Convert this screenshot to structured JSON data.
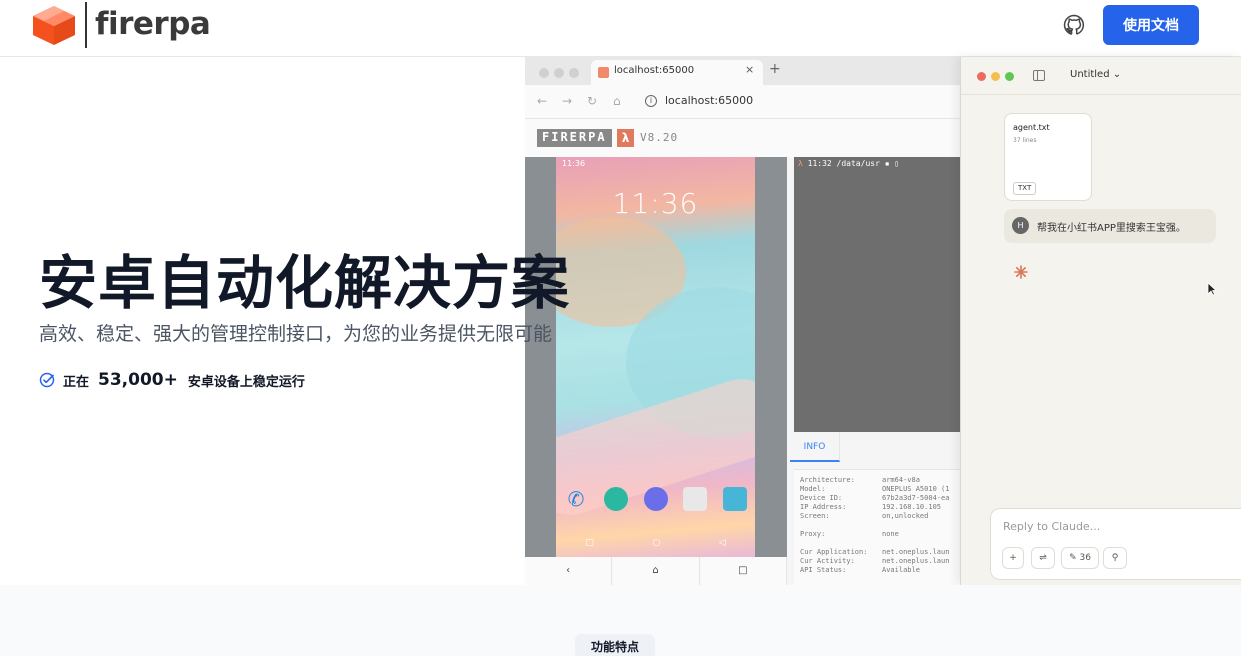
{
  "nav": {
    "brand": "firerpa",
    "docs_button": "使用文档",
    "logo_icon": "box-logo-icon",
    "github_icon": "github-icon",
    "accent_color": "#2563eb"
  },
  "hero": {
    "title": "安卓自动化解决方案",
    "subtitle": "高效、稳定、强大的管理控制接口，为您的业务提供无限可能",
    "stat_prefix": "正在",
    "stat_number": "53,000+",
    "stat_suffix": "安卓设备上稳定运行"
  },
  "browser": {
    "tab_title": "localhost:65000",
    "new_tab": "+",
    "close_tab": "×",
    "url": "localhost:65000",
    "brand": "FIRERPA",
    "lambda": "λ",
    "version": "V8.20",
    "phone": {
      "status_time": "11:36",
      "lock_time": "11:36",
      "controls": [
        "‹",
        "⌂",
        "□"
      ],
      "navbar": [
        "□",
        "○",
        "◁"
      ]
    },
    "terminal": {
      "prompt": "λ",
      "line": " 11:32 /data/usr ▪ ▯"
    },
    "info": {
      "tab": "INFO",
      "rows": [
        {
          "key": "Architecture:",
          "value": "arm64-v8a"
        },
        {
          "key": "Model:",
          "value": "ONEPLUS A5010 (1"
        },
        {
          "key": "Device ID:",
          "value": "67b2a3d7-5004-ea"
        },
        {
          "key": "IP Address:",
          "value": "192.168.10.105"
        },
        {
          "key": "Screen:",
          "value": "on,unlocked"
        },
        {
          "key": "Proxy:",
          "value": "none"
        },
        {
          "key": "Cur Application:",
          "value": "net.oneplus.laun"
        },
        {
          "key": "Cur Activity:",
          "value": "net.oneplus.laun"
        },
        {
          "key": "API Status:",
          "value": "Available"
        }
      ]
    }
  },
  "claude": {
    "title": "Untitled",
    "file_name": "agent.txt",
    "file_lines": "37 lines",
    "file_badge": "TXT",
    "avatar": "H",
    "message": "帮我在小红书APP里搜索王宝强。",
    "reply_placeholder": "Reply to Claude...",
    "tools": [
      "+",
      "⇌",
      "✎ 36",
      "⚲"
    ]
  },
  "section": {
    "badge": "功能特点"
  }
}
